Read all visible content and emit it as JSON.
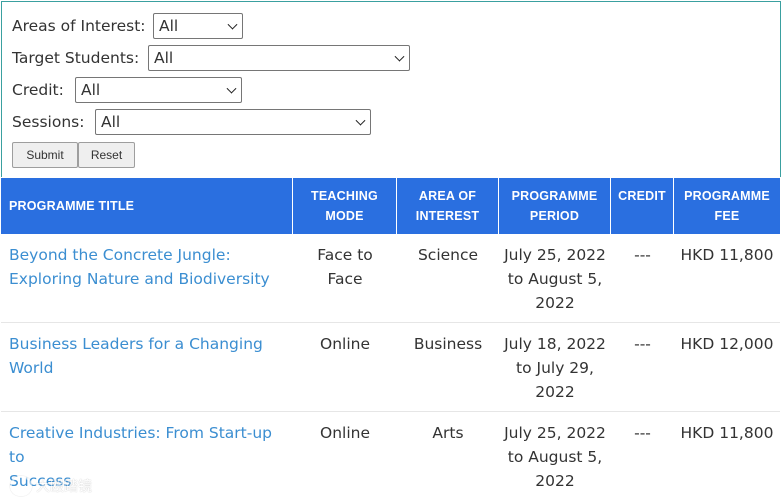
{
  "filters": [
    {
      "label": "Areas of Interest:",
      "value": "All"
    },
    {
      "label": "Target Students:",
      "value": "All"
    },
    {
      "label": "Credit:",
      "value": "All"
    },
    {
      "label": "Sessions:",
      "value": "All"
    }
  ],
  "buttons": {
    "submit": "Submit",
    "reset": "Reset"
  },
  "table": {
    "headers": {
      "title": "PROGRAMME TITLE",
      "mode_1": "TEACHING",
      "mode_2": "MODE",
      "area_1": "AREA OF",
      "area_2": "INTEREST",
      "period_1": "PROGRAMME",
      "period_2": "PERIOD",
      "credit": "CREDIT",
      "fee_1": "PROGRAMME",
      "fee_2": "FEE"
    },
    "rows": [
      {
        "title_1": "Beyond the Concrete Jungle:",
        "title_2": "Exploring Nature and Biodiversity",
        "mode_1": "Face to",
        "mode_2": "Face",
        "area": "Science",
        "period_1": "July 25, 2022",
        "period_2": "to August 5,",
        "period_3": "2022",
        "credit": "---",
        "fee": "HKD 11,800"
      },
      {
        "title_1": "Business Leaders for a Changing",
        "title_2": "World",
        "mode_1": "Online",
        "mode_2": "",
        "area": "Business",
        "period_1": "July 18, 2022",
        "period_2": "to July 29,",
        "period_3": "2022",
        "credit": "---",
        "fee": "HKD 12,000"
      },
      {
        "title_1": "Creative Industries: From Start-up to",
        "title_2": "Success",
        "mode_1": "Online",
        "mode_2": "",
        "area": "Arts",
        "period_1": "July 25, 2022",
        "period_2": "to August 5,",
        "period_3": "2022",
        "credit": "---",
        "fee": "HKD 11,800"
      }
    ]
  },
  "watermark": {
    "text": "大殴踏镜"
  },
  "colors": {
    "header_bg": "#2a6fe0",
    "link": "#3b8ed1",
    "panel_border": "#3aa0a0"
  }
}
